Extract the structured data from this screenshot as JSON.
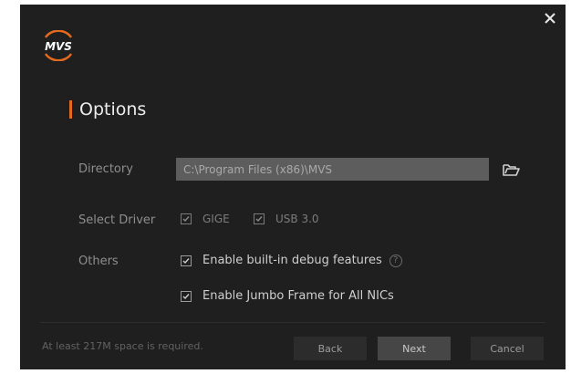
{
  "app": {
    "logo_text": "MVS",
    "title": "Options"
  },
  "directory": {
    "label": "Directory",
    "value": "C:\\Program Files (x86)\\MVS"
  },
  "driver": {
    "label": "Select Driver",
    "options": [
      {
        "label": "GIGE",
        "checked": true
      },
      {
        "label": "USB 3.0",
        "checked": true
      }
    ]
  },
  "others": {
    "label": "Others",
    "options": [
      {
        "label": "Enable built-in debug features",
        "checked": true
      },
      {
        "label": "Enable Jumbo Frame for All NICs",
        "checked": true
      }
    ],
    "help_icon": "?"
  },
  "footer": {
    "note": "At least 217M space is required.",
    "back_label": "Back",
    "next_label": "Next",
    "cancel_label": "Cancel"
  },
  "colors": {
    "background": "#1f1f1f",
    "accent": "#e36a1f",
    "input_bg": "#5d5d5d"
  },
  "icons": {
    "close": "close-icon",
    "folder": "folder-open-icon",
    "help": "help-circle-icon",
    "check": "check-icon"
  }
}
